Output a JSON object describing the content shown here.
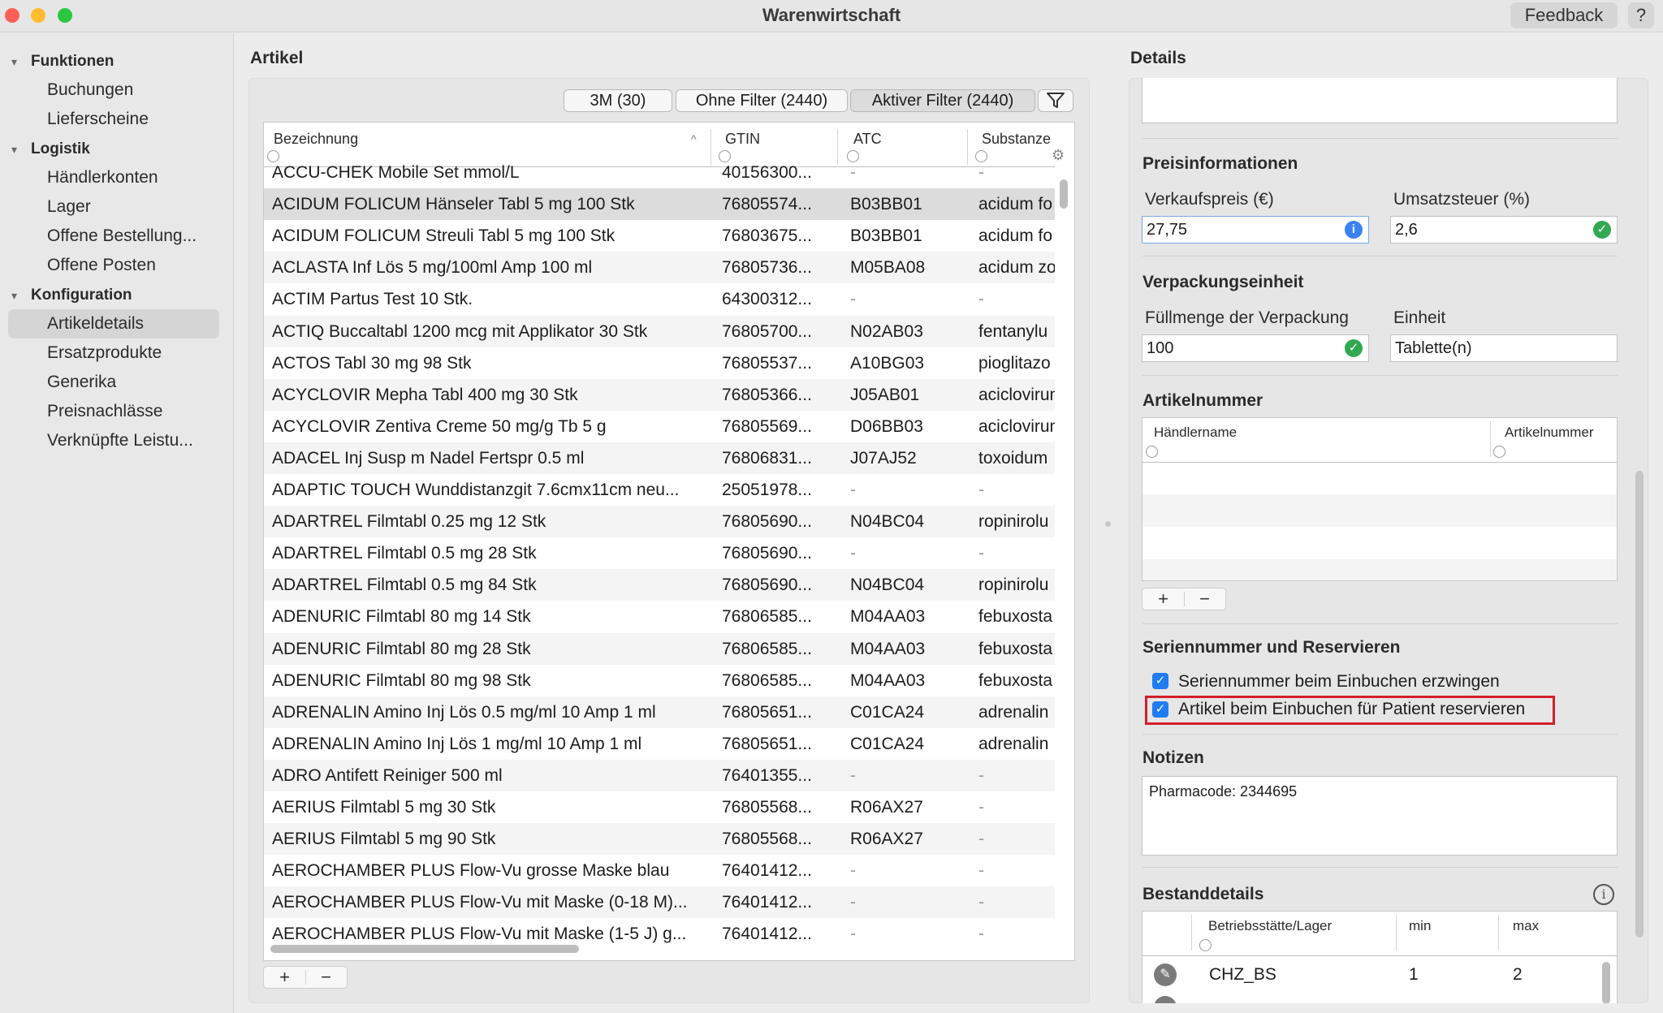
{
  "window": {
    "title": "Warenwirtschaft",
    "feedback_label": "Feedback",
    "help_label": "?"
  },
  "sidebar": {
    "groups": [
      {
        "label": "Funktionen",
        "items": [
          "Buchungen",
          "Lieferscheine"
        ]
      },
      {
        "label": "Logistik",
        "items": [
          "Händlerkonten",
          "Lager",
          "Offene Bestellung...",
          "Offene Posten"
        ]
      },
      {
        "label": "Konfiguration",
        "items": [
          "Artikeldetails",
          "Ersatzprodukte",
          "Generika",
          "Preisnachlässe",
          "Verknüpfte Leistu..."
        ]
      }
    ],
    "selected": "Artikeldetails"
  },
  "articles": {
    "title": "Artikel",
    "filters": [
      "3M (30)",
      "Ohne Filter (2440)",
      "Aktiver Filter (2440)"
    ],
    "columns": [
      "Bezeichnung",
      "GTIN",
      "ATC",
      "Substanze"
    ],
    "rows": [
      [
        "ACCU-CHEK Mobile Set mmol/L",
        "40156300...",
        "-",
        "-"
      ],
      [
        "ACIDUM FOLICUM Hänseler Tabl 5 mg 100 Stk",
        "76805574...",
        "B03BB01",
        "acidum fo"
      ],
      [
        "ACIDUM FOLICUM Streuli Tabl 5 mg 100 Stk",
        "76803675...",
        "B03BB01",
        "acidum fo"
      ],
      [
        "ACLASTA Inf Lös 5 mg/100ml Amp 100 ml",
        "76805736...",
        "M05BA08",
        "acidum zo"
      ],
      [
        "ACTIM Partus Test 10 Stk.",
        "64300312...",
        "-",
        "-"
      ],
      [
        "ACTIQ Buccaltabl 1200 mcg mit Applikator 30 Stk",
        "76805700...",
        "N02AB03",
        "fentanylu"
      ],
      [
        "ACTOS Tabl 30 mg 98 Stk",
        "76805537...",
        "A10BG03",
        "pioglitazo"
      ],
      [
        "ACYCLOVIR Mepha Tabl 400 mg 30 Stk",
        "76805366...",
        "J05AB01",
        "aciclovirum"
      ],
      [
        "ACYCLOVIR Zentiva Creme 50 mg/g Tb 5 g",
        "76805569...",
        "D06BB03",
        "aciclovirum"
      ],
      [
        "ADACEL Inj Susp m Nadel Fertspr 0.5 ml",
        "76806831...",
        "J07AJ52",
        "toxoidum"
      ],
      [
        "ADAPTIC TOUCH Wunddistanzgit 7.6cmx11cm neu...",
        "25051978...",
        "-",
        "-"
      ],
      [
        "ADARTREL Filmtabl 0.25 mg 12 Stk",
        "76805690...",
        "N04BC04",
        "ropinirolu"
      ],
      [
        "ADARTREL Filmtabl 0.5 mg 28 Stk",
        "76805690...",
        "-",
        "-"
      ],
      [
        "ADARTREL Filmtabl 0.5 mg 84 Stk",
        "76805690...",
        "N04BC04",
        "ropinirolu"
      ],
      [
        "ADENURIC Filmtabl 80 mg 14 Stk",
        "76806585...",
        "M04AA03",
        "febuxosta"
      ],
      [
        "ADENURIC Filmtabl 80 mg 28 Stk",
        "76806585...",
        "M04AA03",
        "febuxosta"
      ],
      [
        "ADENURIC Filmtabl 80 mg 98 Stk",
        "76806585...",
        "M04AA03",
        "febuxosta"
      ],
      [
        "ADRENALIN Amino Inj Lös 0.5 mg/ml 10 Amp 1 ml",
        "76805651...",
        "C01CA24",
        "adrenalin"
      ],
      [
        "ADRENALIN Amino Inj Lös 1 mg/ml 10 Amp 1 ml",
        "76805651...",
        "C01CA24",
        "adrenalin"
      ],
      [
        "ADRO Antifett Reiniger 500 ml",
        "76401355...",
        "-",
        "-"
      ],
      [
        "AERIUS Filmtabl 5 mg 30 Stk",
        "76805568...",
        "R06AX27",
        "-"
      ],
      [
        "AERIUS Filmtabl 5 mg 90 Stk",
        "76805568...",
        "R06AX27",
        "-"
      ],
      [
        "AEROCHAMBER PLUS Flow-Vu grosse Maske blau",
        "76401412...",
        "-",
        "-"
      ],
      [
        "AEROCHAMBER PLUS Flow-Vu mit Maske (0-18 M)...",
        "76401412...",
        "-",
        "-"
      ],
      [
        "AEROCHAMBER PLUS Flow-Vu mit Maske (1-5 J) g...",
        "76401412...",
        "-",
        "-"
      ]
    ],
    "selected_row": 1,
    "add_label": "+",
    "remove_label": "−"
  },
  "details": {
    "title": "Details",
    "price": {
      "title": "Preisinformationen",
      "sale_label": "Verkaufspreis (€)",
      "sale_value": "27,75",
      "vat_label": "Umsatzsteuer (%)",
      "vat_value": "2,6"
    },
    "packaging": {
      "title": "Verpackungseinheit",
      "fill_label": "Füllmenge der Verpackung",
      "fill_value": "100",
      "unit_label": "Einheit",
      "unit_value": "Tablette(n)"
    },
    "article_number": {
      "title": "Artikelnummer",
      "columns": [
        "Händlername",
        "Artikelnummer"
      ],
      "add_label": "+",
      "remove_label": "−"
    },
    "serial": {
      "title": "Seriennummer und Reservieren",
      "option1": "Seriennummer beim Einbuchen erzwingen",
      "option1_checked": true,
      "option2": "Artikel beim Einbuchen für Patient reservieren",
      "option2_checked": true
    },
    "notes": {
      "title": "Notizen",
      "text": "Pharmacode: 2344695"
    },
    "stock": {
      "title": "Bestanddetails",
      "columns": [
        "Betriebsstätte/Lager",
        "min",
        "max"
      ],
      "rows": [
        {
          "location": "CHZ_BS",
          "min": "1",
          "max": "2"
        }
      ]
    }
  },
  "colors": {
    "accent": "#1f7cf2",
    "highlight": "#d21f2b",
    "ok": "#32a852",
    "info": "#3b82f6"
  }
}
